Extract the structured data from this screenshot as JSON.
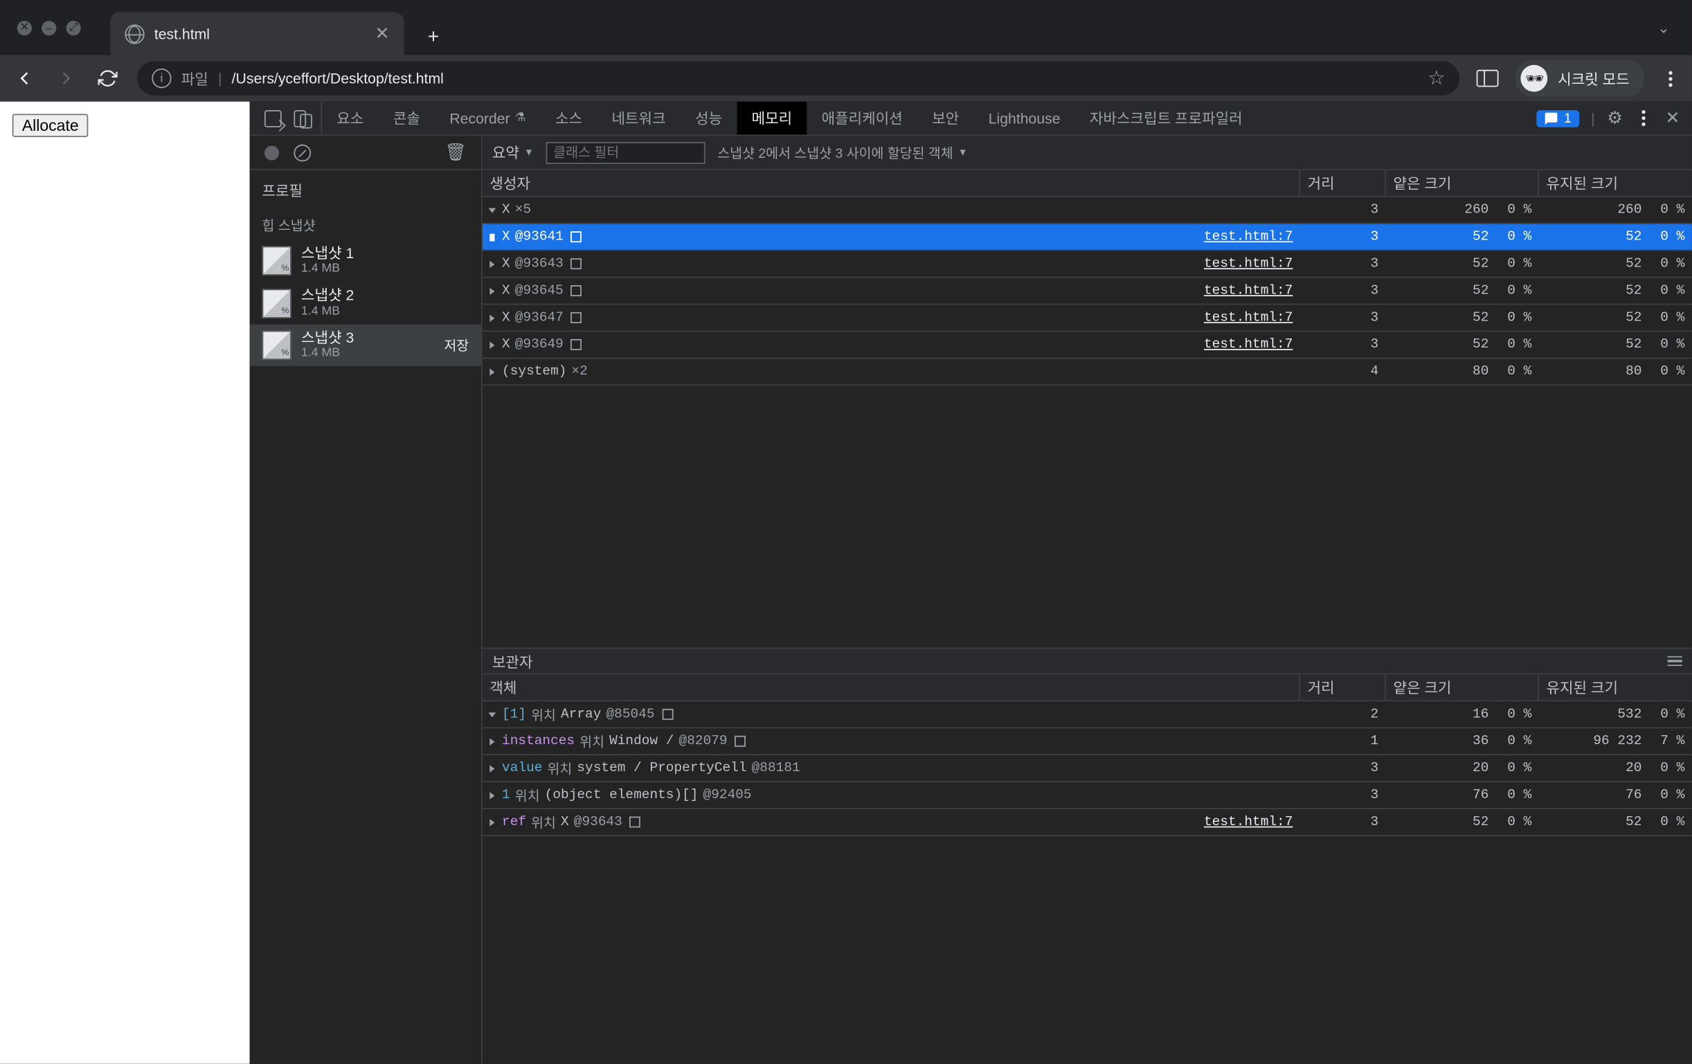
{
  "browser": {
    "tab_title": "test.html",
    "new_tab": "+",
    "omnibox": {
      "file_label": "파일",
      "path": "/Users/yceffort/Desktop/test.html"
    },
    "incognito_label": "시크릿 모드"
  },
  "page": {
    "allocate_button": "Allocate"
  },
  "devtools": {
    "tabs": {
      "elements": "요소",
      "console": "콘솔",
      "recorder": "Recorder",
      "sources": "소스",
      "network": "네트워크",
      "performance": "성능",
      "memory": "메모리",
      "application": "애플리케이션",
      "security": "보안",
      "lighthouse": "Lighthouse",
      "profiler": "자바스크립트 프로파일러"
    },
    "issues_count": "1",
    "sidebar": {
      "profiles_label": "프로필",
      "heap_snapshots_label": "힙 스냅샷",
      "snapshots": [
        {
          "name": "스냅샷 1",
          "size": "1.4 MB"
        },
        {
          "name": "스냅샷 2",
          "size": "1.4 MB"
        },
        {
          "name": "스냅샷 3",
          "size": "1.4 MB"
        }
      ],
      "save_label": "저장"
    },
    "filter": {
      "summary": "요약",
      "class_filter_placeholder": "클래스 필터",
      "comparison_text": "스냅샷 2에서 스냅샷 3 사이에 할당된 객체"
    },
    "columns": {
      "constructor": "생성자",
      "distance": "거리",
      "shallow": "얕은 크기",
      "retained": "유지된 크기"
    },
    "rows": [
      {
        "indent": 0,
        "open": true,
        "label": "X",
        "count": "×5",
        "link": "",
        "dist": "3",
        "shallow": "260",
        "shallow_pct": "0 %",
        "retained": "260",
        "retained_pct": "0 %",
        "sel": false,
        "sq": false
      },
      {
        "indent": 1,
        "open": false,
        "label": "X",
        "id": "@93641",
        "link": "test.html:7",
        "dist": "3",
        "shallow": "52",
        "shallow_pct": "0 %",
        "retained": "52",
        "retained_pct": "0 %",
        "sel": true,
        "sq": true
      },
      {
        "indent": 1,
        "open": false,
        "label": "X",
        "id": "@93643",
        "link": "test.html:7",
        "dist": "3",
        "shallow": "52",
        "shallow_pct": "0 %",
        "retained": "52",
        "retained_pct": "0 %",
        "sel": false,
        "sq": true
      },
      {
        "indent": 1,
        "open": false,
        "label": "X",
        "id": "@93645",
        "link": "test.html:7",
        "dist": "3",
        "shallow": "52",
        "shallow_pct": "0 %",
        "retained": "52",
        "retained_pct": "0 %",
        "sel": false,
        "sq": true
      },
      {
        "indent": 1,
        "open": false,
        "label": "X",
        "id": "@93647",
        "link": "test.html:7",
        "dist": "3",
        "shallow": "52",
        "shallow_pct": "0 %",
        "retained": "52",
        "retained_pct": "0 %",
        "sel": false,
        "sq": true
      },
      {
        "indent": 1,
        "open": false,
        "label": "X",
        "id": "@93649",
        "link": "test.html:7",
        "dist": "3",
        "shallow": "52",
        "shallow_pct": "0 %",
        "retained": "52",
        "retained_pct": "0 %",
        "sel": false,
        "sq": true
      },
      {
        "indent": 0,
        "open": false,
        "label": "(system)",
        "count": "×2",
        "link": "",
        "dist": "4",
        "shallow": "80",
        "shallow_pct": "0 %",
        "retained": "80",
        "retained_pct": "0 %",
        "sel": false,
        "sq": false
      }
    ],
    "retainers": {
      "title": "보관자",
      "columns": {
        "object": "객체",
        "distance": "거리",
        "shallow": "얕은 크기",
        "retained": "유지된 크기"
      },
      "rows": [
        {
          "indent": 0,
          "open": true,
          "prefix": "[1]",
          "loc": "위치",
          "label": "Array",
          "id": "@85045",
          "sq": true,
          "link": "",
          "dist": "2",
          "shallow": "16",
          "shallow_pct": "0 %",
          "retained": "532",
          "retained_pct": "0 %"
        },
        {
          "indent": 1,
          "open": false,
          "prefix_purple": "instances",
          "loc": "위치",
          "label": "Window /",
          "id": "@82079",
          "sq": true,
          "link": "",
          "dist": "1",
          "shallow": "36",
          "shallow_pct": "0 %",
          "retained": "96 232",
          "retained_pct": "7 %"
        },
        {
          "indent": 1,
          "open": false,
          "prefix": "value",
          "loc": "위치",
          "label": "system / PropertyCell",
          "id": "@88181",
          "sq": false,
          "link": "",
          "dist": "3",
          "shallow": "20",
          "shallow_pct": "0 %",
          "retained": "20",
          "retained_pct": "0 %"
        },
        {
          "indent": 0,
          "open": false,
          "prefix": "1",
          "loc": "위치",
          "label": "(object elements)[]",
          "id": "@92405",
          "sq": false,
          "link": "",
          "dist": "3",
          "shallow": "76",
          "shallow_pct": "0 %",
          "retained": "76",
          "retained_pct": "0 %"
        },
        {
          "indent": 0,
          "open": false,
          "prefix_purple": "ref",
          "loc": "위치",
          "label": "X",
          "id": "@93643",
          "sq": true,
          "link": "test.html:7",
          "dist": "3",
          "shallow": "52",
          "shallow_pct": "0 %",
          "retained": "52",
          "retained_pct": "0 %"
        }
      ]
    }
  }
}
